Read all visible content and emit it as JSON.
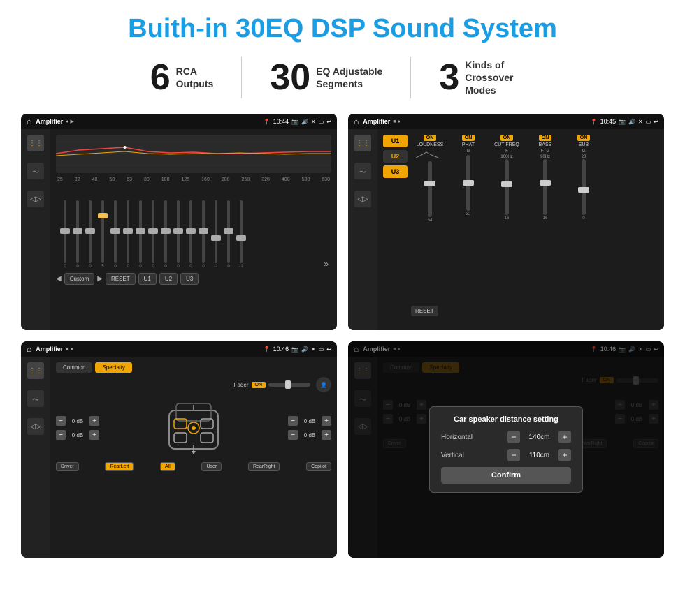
{
  "page": {
    "title": "Buith-in 30EQ DSP Sound System",
    "stats": [
      {
        "number": "6",
        "label": "RCA\nOutputs"
      },
      {
        "number": "30",
        "label": "EQ Adjustable\nSegments"
      },
      {
        "number": "3",
        "label": "Kinds of\nCrossover Modes"
      }
    ]
  },
  "screens": [
    {
      "id": "screen1",
      "status": {
        "app": "Amplifier",
        "time": "10:44"
      },
      "type": "eq"
    },
    {
      "id": "screen2",
      "status": {
        "app": "Amplifier",
        "time": "10:45"
      },
      "type": "mixer"
    },
    {
      "id": "screen3",
      "status": {
        "app": "Amplifier",
        "time": "10:46"
      },
      "type": "fader"
    },
    {
      "id": "screen4",
      "status": {
        "app": "Amplifier",
        "time": "10:46"
      },
      "type": "fader-dialog"
    }
  ],
  "eq_screen": {
    "freqs": [
      "25",
      "32",
      "40",
      "50",
      "63",
      "80",
      "100",
      "125",
      "160",
      "200",
      "250",
      "320",
      "400",
      "500",
      "630"
    ],
    "values": [
      "0",
      "0",
      "0",
      "5",
      "0",
      "0",
      "0",
      "0",
      "0",
      "0",
      "0",
      "0",
      "-1",
      "0",
      "-1"
    ],
    "buttons": [
      "Custom",
      "RESET",
      "U1",
      "U2",
      "U3"
    ]
  },
  "mixer_screen": {
    "u_buttons": [
      "U1",
      "U2",
      "U3"
    ],
    "channels": [
      {
        "label": "LOUDNESS",
        "on": true
      },
      {
        "label": "PHAT",
        "on": true
      },
      {
        "label": "CUT FREQ",
        "on": true
      },
      {
        "label": "BASS",
        "on": true
      },
      {
        "label": "SUB",
        "on": true
      }
    ],
    "reset_label": "RESET"
  },
  "fader_screen": {
    "tabs": [
      "Common",
      "Specialty"
    ],
    "fader_label": "Fader",
    "on_label": "ON",
    "db_values": [
      "0 dB",
      "0 dB",
      "0 dB",
      "0 dB"
    ],
    "bottom_labels": [
      "Driver",
      "RearLeft",
      "All",
      "User",
      "RearRight",
      "Copilot"
    ]
  },
  "dialog_screen": {
    "title": "Car speaker distance setting",
    "horizontal_label": "Horizontal",
    "horizontal_value": "140cm",
    "vertical_label": "Vertical",
    "vertical_value": "110cm",
    "confirm_label": "Confirm",
    "minus_label": "−",
    "plus_label": "+"
  }
}
